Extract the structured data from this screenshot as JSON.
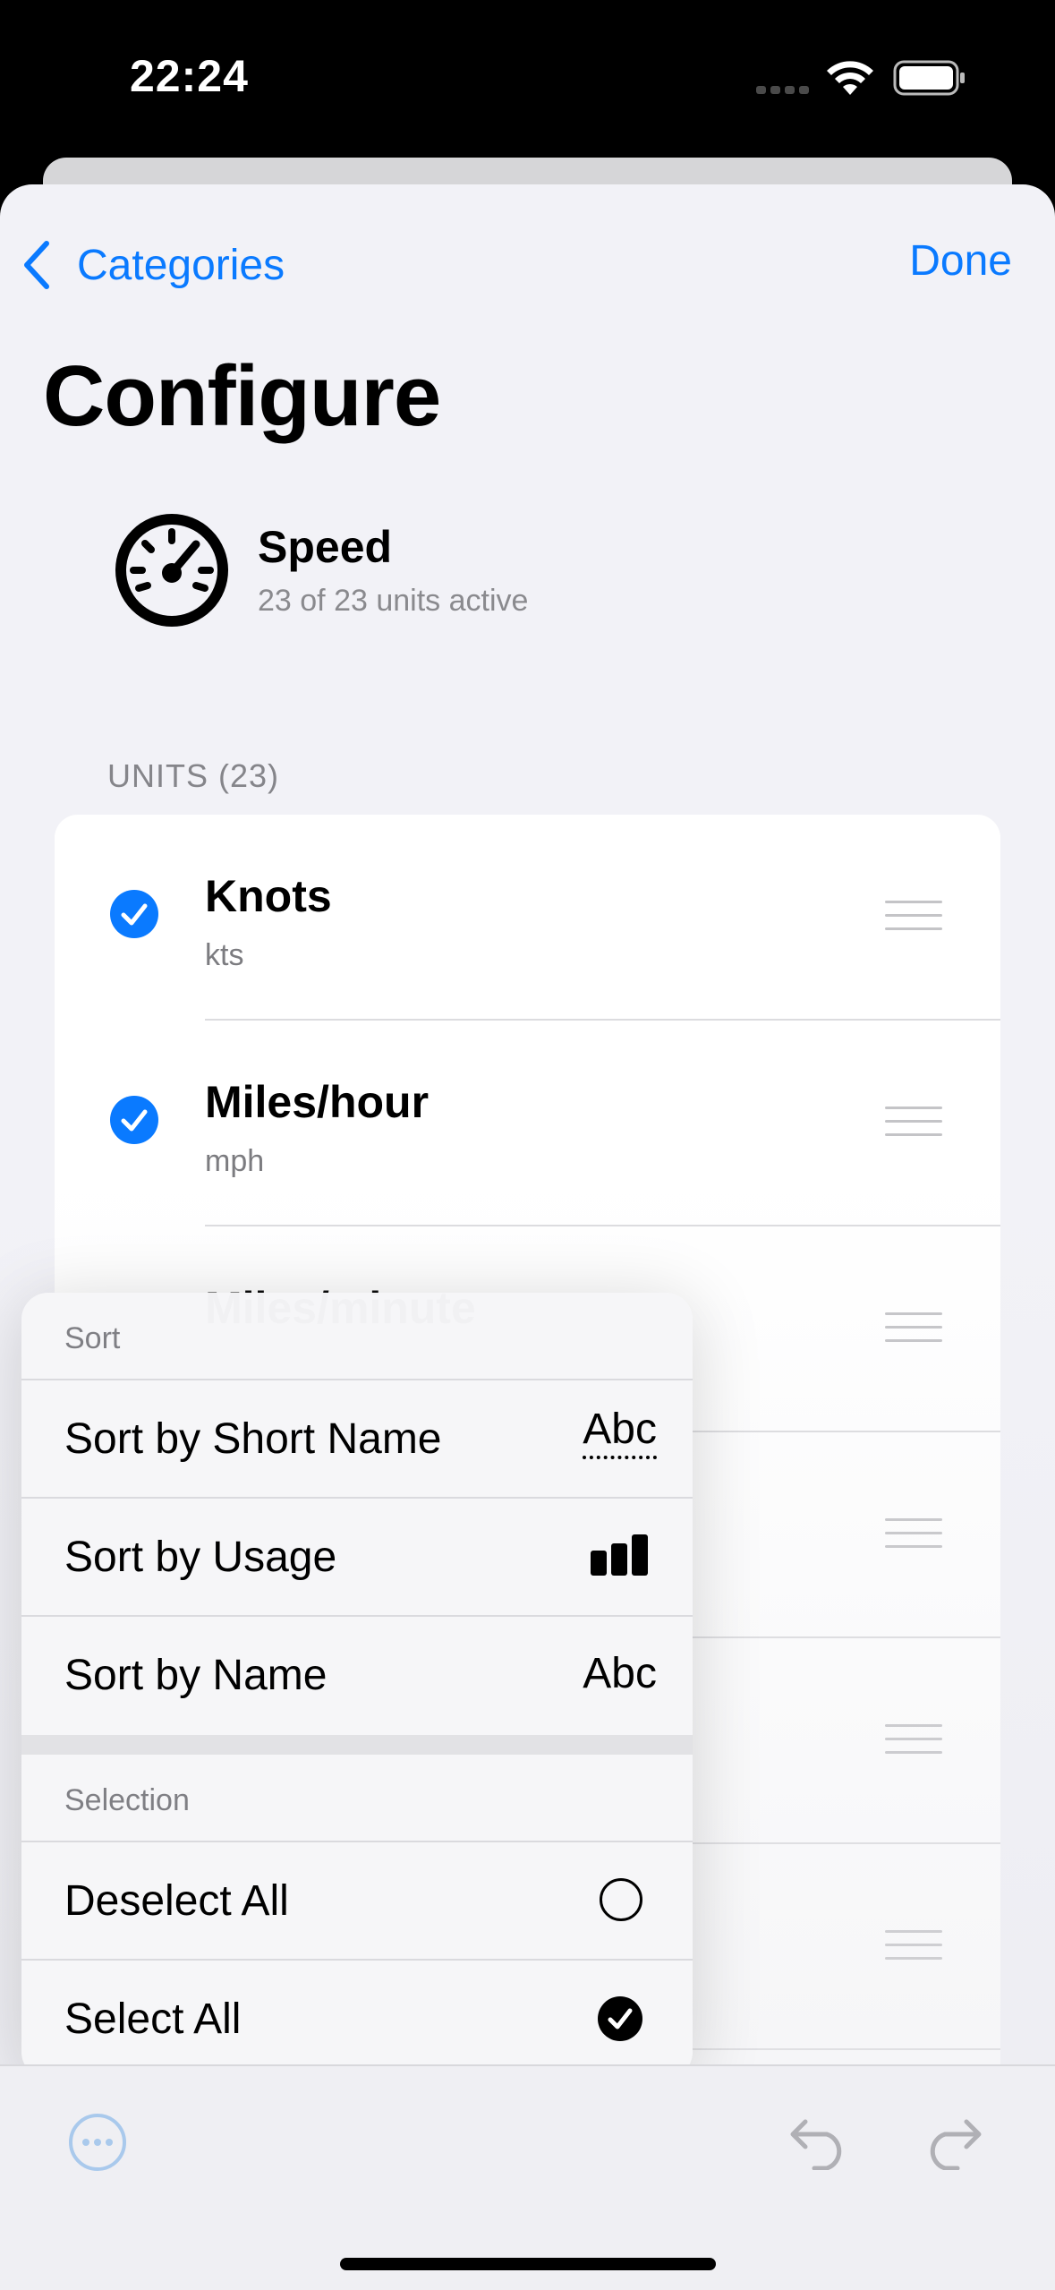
{
  "status_bar": {
    "time": "22:24"
  },
  "nav": {
    "back_label": "Categories",
    "done_label": "Done"
  },
  "page": {
    "title": "Configure"
  },
  "category": {
    "name": "Speed",
    "subtitle": "23 of 23 units active",
    "icon": "speedometer-icon"
  },
  "units_section": {
    "header": "UNITS (23)"
  },
  "units": [
    {
      "name": "Knots",
      "short": "kts",
      "checked": true
    },
    {
      "name": "Miles/hour",
      "short": "mph",
      "checked": true
    },
    {
      "name": "Miles/minute",
      "short": "",
      "checked": true
    }
  ],
  "menu": {
    "sort_header": "Sort",
    "sort_items": [
      {
        "label": "Sort by Short Name",
        "icon_text": "Abc"
      },
      {
        "label": "Sort by Usage",
        "icon": "bar-chart-icon"
      },
      {
        "label": "Sort by Name",
        "icon_text": "Abc"
      }
    ],
    "selection_header": "Selection",
    "selection_items": [
      {
        "label": "Deselect All",
        "icon": "empty-circle-icon"
      },
      {
        "label": "Select All",
        "icon": "checkmark-circle-icon"
      }
    ]
  },
  "colors": {
    "accent": "#0a7aff",
    "background": "#f2f2f7"
  }
}
